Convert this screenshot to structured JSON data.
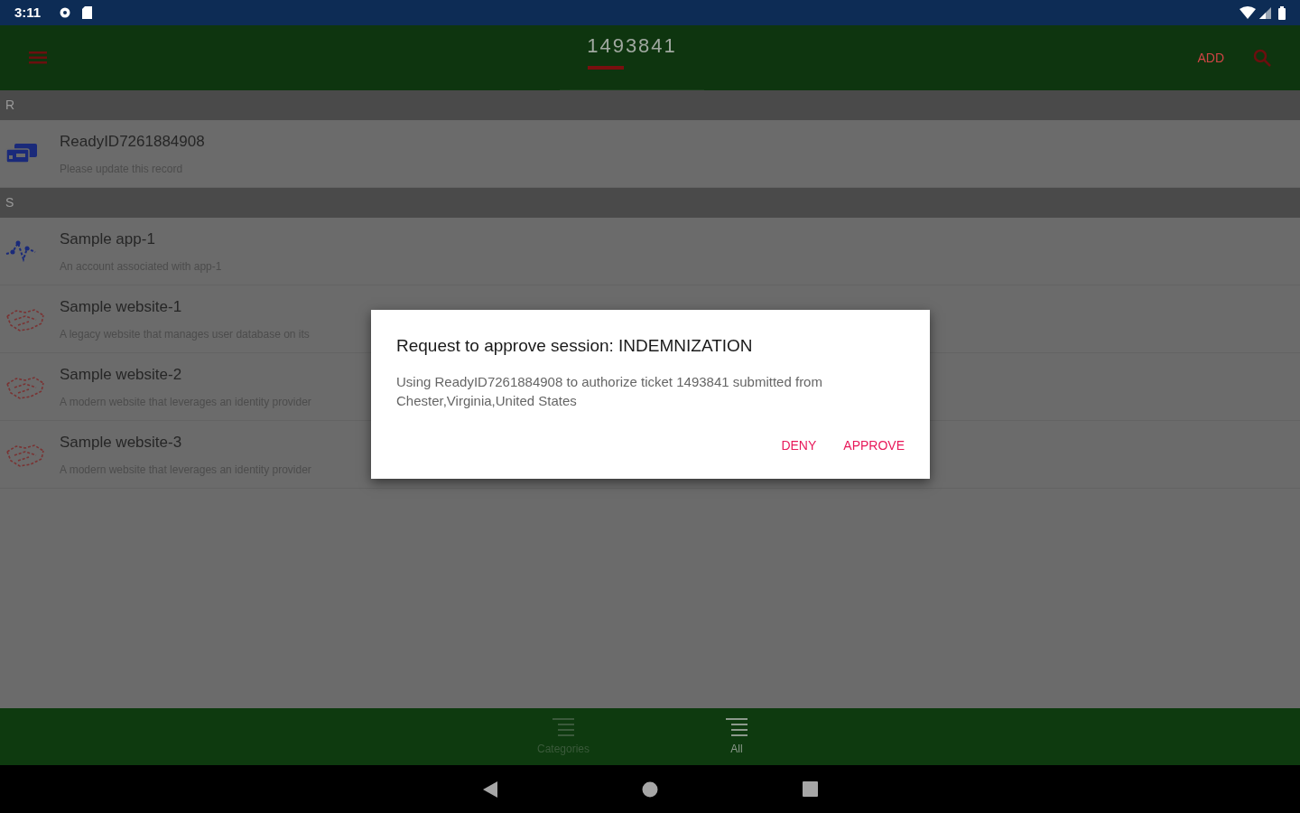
{
  "status_bar": {
    "time": "3:11"
  },
  "app_bar": {
    "tabs": [
      {
        "label": "1493841",
        "selected": true
      }
    ],
    "add_label": "ADD"
  },
  "sections": [
    {
      "letter": "R",
      "items": [
        {
          "kind": "card",
          "title": "ReadyID7261884908",
          "subtitle": "Please update this record"
        }
      ]
    },
    {
      "letter": "S",
      "items": [
        {
          "kind": "app",
          "title": "Sample app-1",
          "subtitle": "An account associated with app-1"
        },
        {
          "kind": "website",
          "title": "Sample website-1",
          "subtitle": "A legacy website that manages user database on its"
        },
        {
          "kind": "website",
          "title": "Sample website-2",
          "subtitle": "A modern website that leverages an identity provider"
        },
        {
          "kind": "website",
          "title": "Sample website-3",
          "subtitle": "A modern website that leverages an identity provider"
        }
      ]
    }
  ],
  "dialog": {
    "title": "Request to approve session: INDEMNIZATION",
    "message": "Using ReadyID7261884908 to authorize ticket 1493841 submitted from Chester,Virginia,United States",
    "buttons": [
      "DENY",
      "APPROVE"
    ]
  },
  "bottom_nav": [
    {
      "label": "Categories",
      "selected": false
    },
    {
      "label": "All",
      "selected": true
    }
  ]
}
